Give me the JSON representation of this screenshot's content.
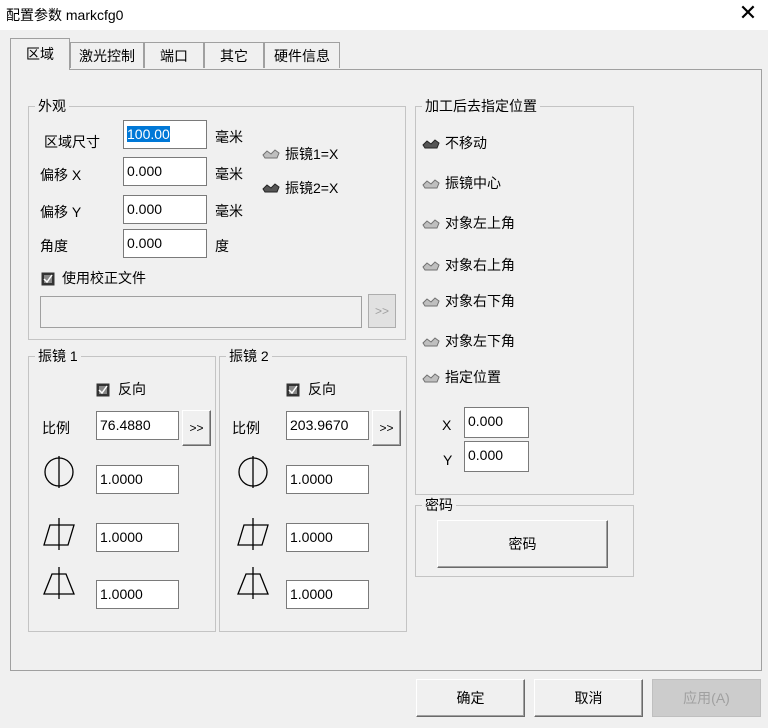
{
  "window": {
    "title": "配置参数 markcfg0",
    "close_glyph": "✕"
  },
  "tabs": [
    {
      "label": "区域",
      "active": true
    },
    {
      "label": "激光控制"
    },
    {
      "label": "端口"
    },
    {
      "label": "其它"
    },
    {
      "label": "硬件信息"
    }
  ],
  "appearance": {
    "title": "外观",
    "area_size_label": "区域尺寸",
    "area_size_value": "100.00",
    "offset_x_label": "偏移 X",
    "offset_x_value": "0.000",
    "offset_y_label": "偏移 Y",
    "offset_y_value": "0.000",
    "angle_label": "角度",
    "angle_value": "0.000",
    "unit_mm": "毫米",
    "unit_deg": "度",
    "galvo1_eq": "振镜1=X",
    "galvo2_eq": "振镜2=X",
    "calib_file_label": "使用校正文件",
    "calib_file_value": "",
    "browse_label": ">>"
  },
  "galvo1": {
    "title": "振镜 1",
    "reverse_label": "反向",
    "scale_label": "比例",
    "scale_value": "76.4880",
    "scale_btn": ">>",
    "param1": "1.0000",
    "param2": "1.0000",
    "param3": "1.0000"
  },
  "galvo2": {
    "title": "振镜 2",
    "reverse_label": "反向",
    "scale_label": "比例",
    "scale_value": "203.9670",
    "scale_btn": ">>",
    "param1": "1.0000",
    "param2": "1.0000",
    "param3": "1.0000"
  },
  "goto_after": {
    "title": "加工后去指定位置",
    "options": [
      "不移动",
      "振镜中心",
      "对象左上角",
      "对象右上角",
      "对象右下角",
      "对象左下角",
      "指定位置"
    ],
    "x_label": "X",
    "x_value": "0.000",
    "y_label": "Y",
    "y_value": "0.000"
  },
  "password": {
    "title": "密码",
    "button_label": "密码"
  },
  "footer": {
    "ok": "确定",
    "cancel": "取消",
    "apply": "应用(A)"
  },
  "icons": {
    "checkbox": "checkbox-icon",
    "radio": "radio-icon",
    "mirror_flip_v": "mirror-vertical-icon",
    "mirror_trapezoid": "mirror-trapezoid-icon",
    "mirror_parallelogram": "mirror-parallelogram-icon"
  }
}
